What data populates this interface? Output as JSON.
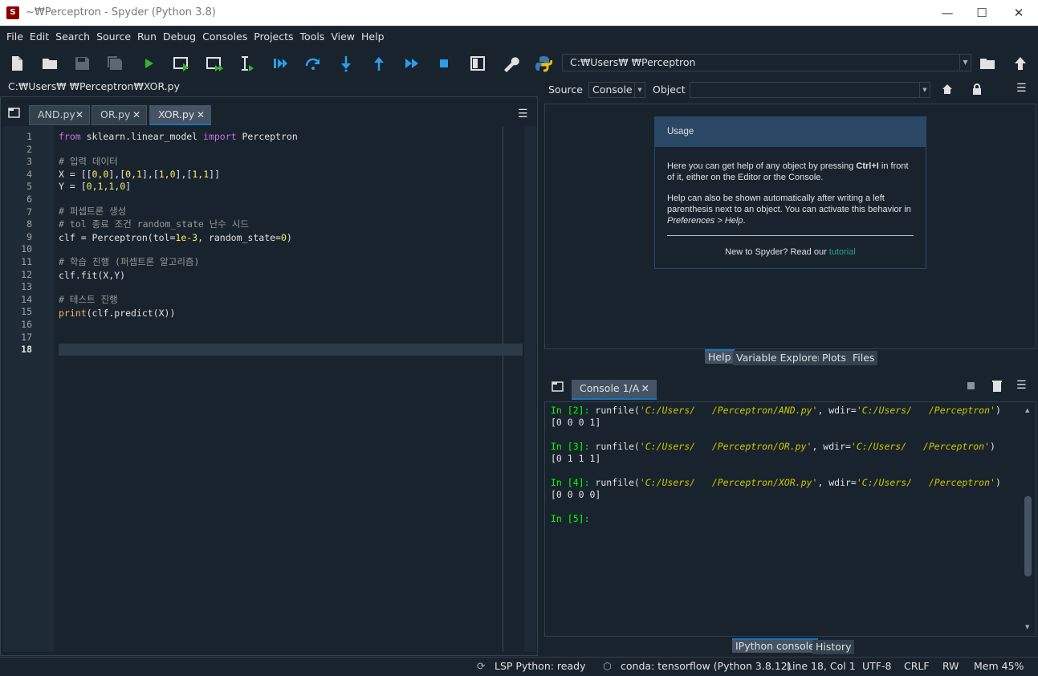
{
  "window": {
    "title": "~₩Perceptron - Spyder (Python 3.8)",
    "app_icon": "spyder-icon",
    "controls": [
      "minimize",
      "maximize",
      "close"
    ]
  },
  "menu": [
    "File",
    "Edit",
    "Search",
    "Source",
    "Run",
    "Debug",
    "Consoles",
    "Projects",
    "Tools",
    "View",
    "Help"
  ],
  "toolbar": {
    "path": "C:₩Users₩      ₩Perceptron"
  },
  "editor": {
    "file_path": "C:₩Users₩      ₩Perceptron₩XOR.py",
    "tabs": [
      {
        "label": "AND.py",
        "active": false
      },
      {
        "label": "OR.py",
        "active": false
      },
      {
        "label": "XOR.py",
        "active": true
      }
    ],
    "line_numbers": [
      "1",
      "2",
      "3",
      "4",
      "5",
      "6",
      "7",
      "8",
      "9",
      "10",
      "11",
      "12",
      "13",
      "14",
      "15",
      "16",
      "17",
      "18"
    ],
    "current_line": "18"
  },
  "help": {
    "source_label": "Source",
    "source_value": "Console",
    "object_label": "Object",
    "object_value": "",
    "usage_title": "Usage",
    "para1_a": "Here you can get help of any object by pressing ",
    "para1_key": "Ctrl+I",
    "para1_b": " in front of it, either on the Editor or the Console.",
    "para2_a": "Help can also be shown automatically after writing a left parenthesis next to an object. You can activate this behavior in ",
    "para2_pref": "Preferences > Help",
    "para2_b": ".",
    "new_text": "New to Spyder? Read our ",
    "tutorial": "tutorial",
    "tabs": [
      "Help",
      "Variable Explorer",
      "Plots",
      "Files"
    ]
  },
  "console": {
    "tab_label": "Console 1/A",
    "bottom_tabs": [
      "IPython console",
      "History"
    ]
  },
  "status": {
    "lsp": "LSP Python: ready",
    "conda": "conda: tensorflow (Python 3.8.12)",
    "position": "Line 18, Col 1",
    "encoding": "UTF-8",
    "eol": "CRLF",
    "rw": "RW",
    "mem": "Mem 45%"
  },
  "colors": {
    "background": "#19232d",
    "border": "#32414b",
    "accent": "#1a72bb",
    "keyword": "#c670e0",
    "number": "#faed5c",
    "comment": "#999999",
    "prompt": "#00ff00",
    "string": "#c8c800"
  }
}
